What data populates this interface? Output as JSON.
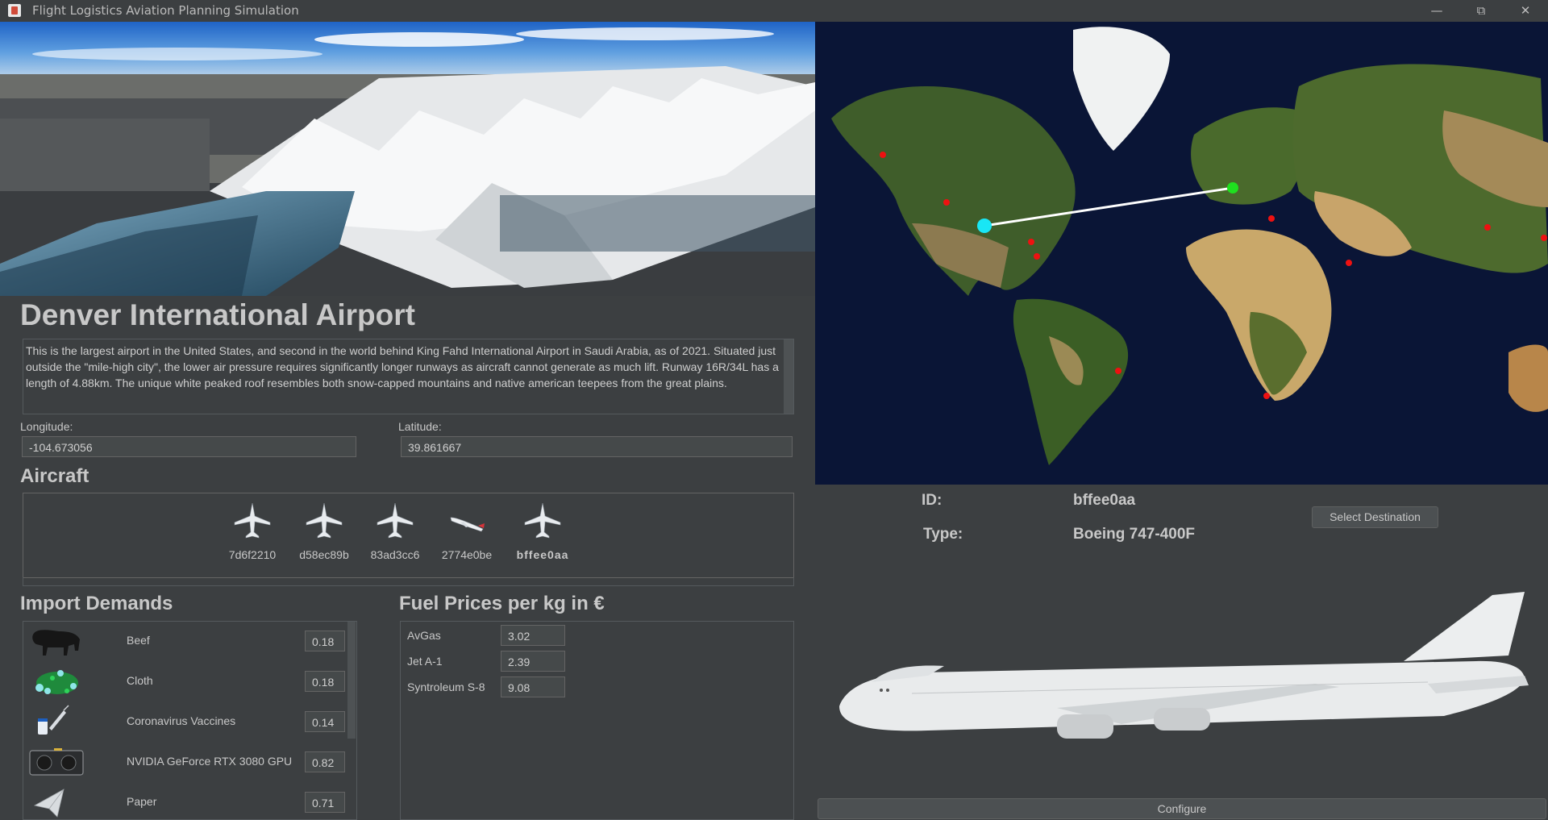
{
  "window": {
    "title": "Flight Logistics Aviation Planning Simulation"
  },
  "airport": {
    "name": "Denver International Airport",
    "description": "This is the largest airport in the United States, and second in the world behind King Fahd International Airport in Saudi Arabia, as of 2021. Situated just outside the \"mile-high city\", the lower air pressure requires significantly longer runways as aircraft cannot generate as much lift. Runway 16R/34L has a length of 4.88km. The unique white peaked roof resembles both snow-capped mountains and native american teepees from the great plains.",
    "longitude_label": "Longitude:",
    "longitude": "-104.673056",
    "latitude_label": "Latitude:",
    "latitude": "39.861667"
  },
  "aircraft": {
    "heading": "Aircraft",
    "items": [
      {
        "id": "7d6f2210",
        "icon": "white-jet-icon"
      },
      {
        "id": "d58ec89b",
        "icon": "white-jet-icon"
      },
      {
        "id": "83ad3cc6",
        "icon": "white-jet-icon"
      },
      {
        "id": "2774e0be",
        "icon": "airliner-side-icon"
      },
      {
        "id": "bffee0aa",
        "icon": "white-jet-icon",
        "selected": true
      }
    ]
  },
  "imports": {
    "heading": "Import Demands",
    "items": [
      {
        "name": "Beef",
        "value": "0.18",
        "icon": "bull-icon"
      },
      {
        "name": "Cloth",
        "value": "0.18",
        "icon": "cloth-icon"
      },
      {
        "name": "Coronavirus Vaccines",
        "value": "0.14",
        "icon": "vaccine-icon"
      },
      {
        "name": "NVIDIA GeForce RTX 3080 GPU",
        "value": "0.82",
        "icon": "gpu-icon"
      },
      {
        "name": "Paper",
        "value": "0.71",
        "icon": "paper-plane-icon"
      }
    ]
  },
  "fuel": {
    "heading": "Fuel Prices per kg in €",
    "items": [
      {
        "name": "AvGas",
        "value": "3.02"
      },
      {
        "name": "Jet A-1",
        "value": "2.39"
      },
      {
        "name": "Syntroleum S-8",
        "value": "9.08"
      }
    ]
  },
  "selected_aircraft": {
    "id_label": "ID:",
    "id": "bffee0aa",
    "type_label": "Type:",
    "type": "Boeing 747-400F"
  },
  "buttons": {
    "select_destination": "Select Destination",
    "configure": "Configure"
  },
  "colors": {
    "background": "#3c3f41",
    "route_line": "#ffffff",
    "origin_marker": "#19e6f5",
    "destination_marker": "#1fe01f",
    "airport_marker": "#ee1111"
  }
}
